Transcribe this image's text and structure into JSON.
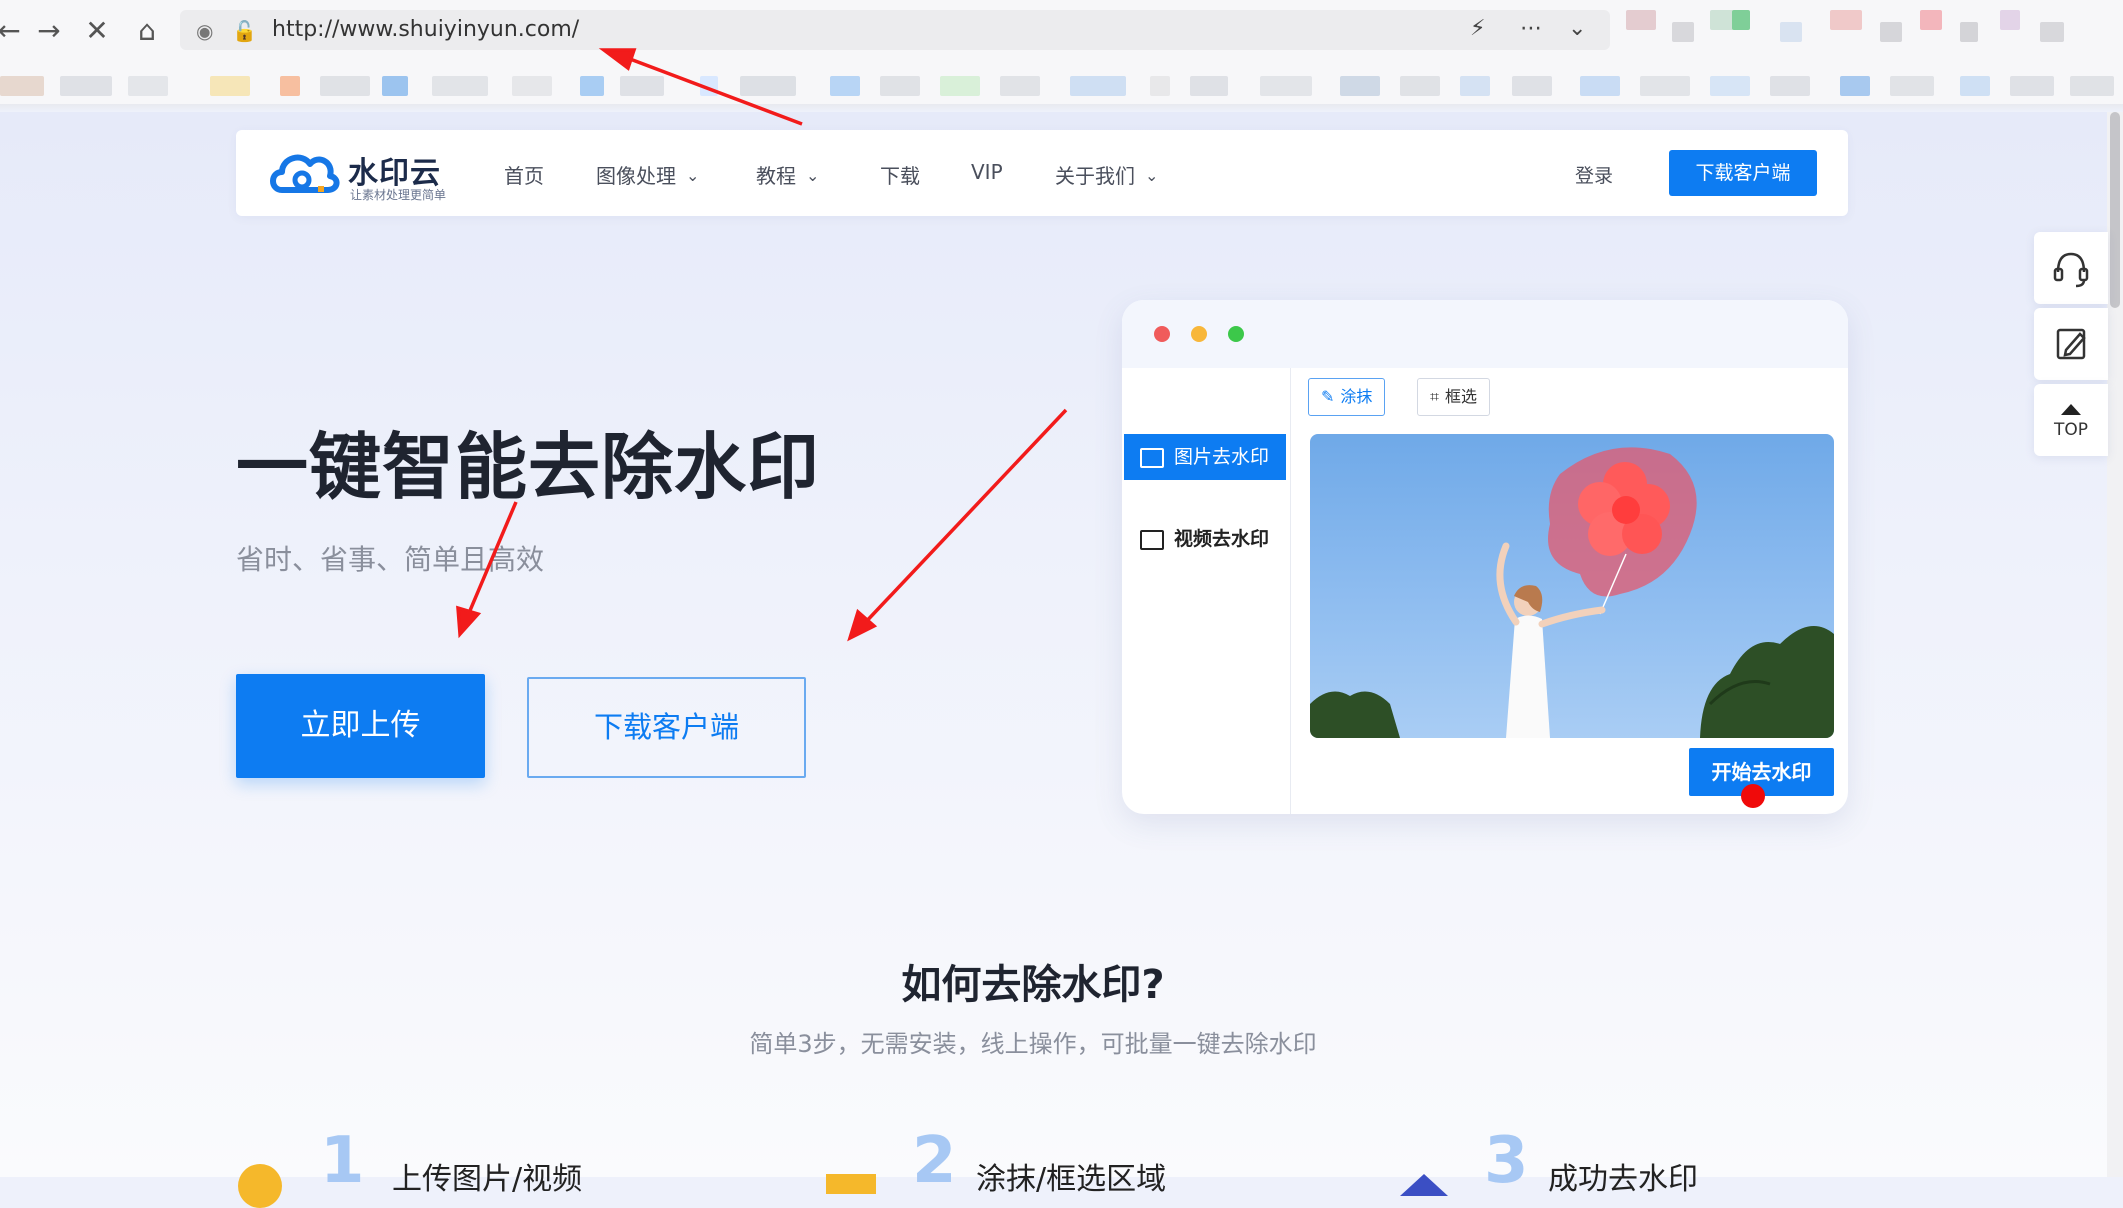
{
  "browser": {
    "url": "http://www.shuiyinyun.com/",
    "back_icon": "arrow-left-icon",
    "forward_icon": "arrow-right-icon",
    "stop_icon": "close-icon",
    "home_icon": "home-icon"
  },
  "site": {
    "logo_name": "水印云",
    "logo_tagline": "让素材处理更简单",
    "nav": [
      "首页",
      "图像处理",
      "教程",
      "下载",
      "VIP",
      "关于我们"
    ],
    "login": "登录",
    "download_client": "下载客户端"
  },
  "hero": {
    "title": "一键智能去除水印",
    "subtitle": "省时、省事、简单且高效",
    "upload_button": "立即上传",
    "client_button": "下载客户端"
  },
  "demo": {
    "side_items": [
      "图片去水印",
      "视频去水印"
    ],
    "tools": [
      "涂抹",
      "框选"
    ],
    "start_button": "开始去水印"
  },
  "float_tools": {
    "top_label": "TOP"
  },
  "how": {
    "title": "如何去除水印?",
    "subtitle": "简单3步，无需安装，线上操作，可批量一键去除水印",
    "steps": [
      {
        "num": "1",
        "label": "上传图片/视频"
      },
      {
        "num": "2",
        "label": "涂抹/框选区域"
      },
      {
        "num": "3",
        "label": "成功去水印"
      }
    ]
  },
  "colors": {
    "brand": "#0d7cf2",
    "annotation": "#f21b1b"
  }
}
